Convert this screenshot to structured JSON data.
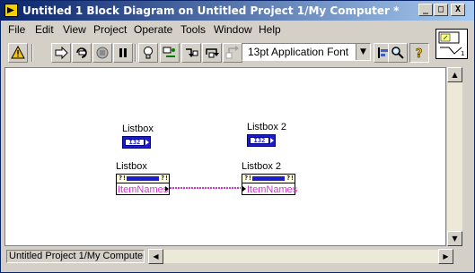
{
  "window": {
    "title": "Untitled 1 Block Diagram on Untitled Project 1/My Computer *",
    "title_icon": "labview-icon",
    "controls": [
      "_",
      "□",
      "X"
    ]
  },
  "menu": [
    "File",
    "Edit",
    "View",
    "Project",
    "Operate",
    "Tools",
    "Window",
    "Help"
  ],
  "toolbar": {
    "buttons": [
      "warning-icon",
      "run-arrow-icon",
      "run-continuous-icon",
      "abort-icon",
      "pause-icon",
      "highlight-execution-icon",
      "retain-wire-values-icon",
      "step-into-icon",
      "step-over-icon",
      "step-out-icon"
    ],
    "font_select": "13pt Application Font",
    "search_icon": "search-icon",
    "help_icon": "help-icon"
  },
  "diagram": {
    "terminals": [
      {
        "label": "Listbox",
        "type": "I32"
      },
      {
        "label": "Listbox 2",
        "type": "I32"
      }
    ],
    "property_nodes": [
      {
        "label": "Listbox",
        "property": "ItemNames"
      },
      {
        "label": "Listbox 2",
        "property": "ItemNames"
      }
    ],
    "wire_color": "#cc33cc"
  },
  "status": {
    "context": "Untitled Project 1/My Computer"
  }
}
